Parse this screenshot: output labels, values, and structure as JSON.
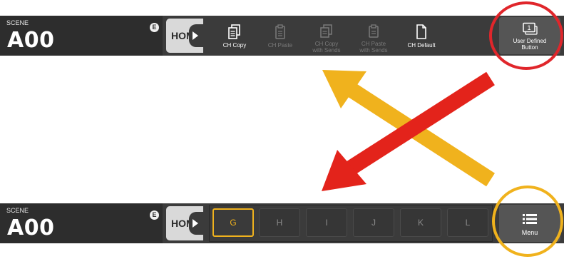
{
  "top_bar": {
    "scene_label": "SCENE",
    "scene_name": "A00",
    "edit_badge": "E",
    "home_label": "HOME",
    "tools": [
      {
        "icon": "ch-copy-icon",
        "label": "CH Copy",
        "enabled": true
      },
      {
        "icon": "ch-paste-icon",
        "label": "CH Paste",
        "enabled": false
      },
      {
        "icon": "ch-copy-sends-icon",
        "label": "CH Copy\nwith Sends",
        "enabled": false
      },
      {
        "icon": "ch-paste-sends-icon",
        "label": "CH Paste\nwith Sends",
        "enabled": false
      },
      {
        "icon": "ch-default-icon",
        "label": "CH Default",
        "enabled": true
      }
    ],
    "user_defined_button": {
      "icon": "user-defined-icon",
      "icon_number": "1",
      "label_line1": "User Defined",
      "label_line2": "Button"
    }
  },
  "bottom_bar": {
    "scene_label": "SCENE",
    "scene_name": "A00",
    "edit_badge": "E",
    "home_label": "HOME",
    "keys": [
      {
        "label": "G",
        "active": true
      },
      {
        "label": "H",
        "active": false
      },
      {
        "label": "I",
        "active": false
      },
      {
        "label": "J",
        "active": false
      },
      {
        "label": "K",
        "active": false
      },
      {
        "label": "L",
        "active": false
      }
    ],
    "menu_button": {
      "icon": "menu-icon",
      "label": "Menu"
    }
  },
  "colors": {
    "bar_bg": "#3b3b3b",
    "scene_bg": "#2d2d2d",
    "accent_yellow": "#f0b21d",
    "arrow_red": "#e3231b",
    "circle_red": "#e0262b"
  }
}
